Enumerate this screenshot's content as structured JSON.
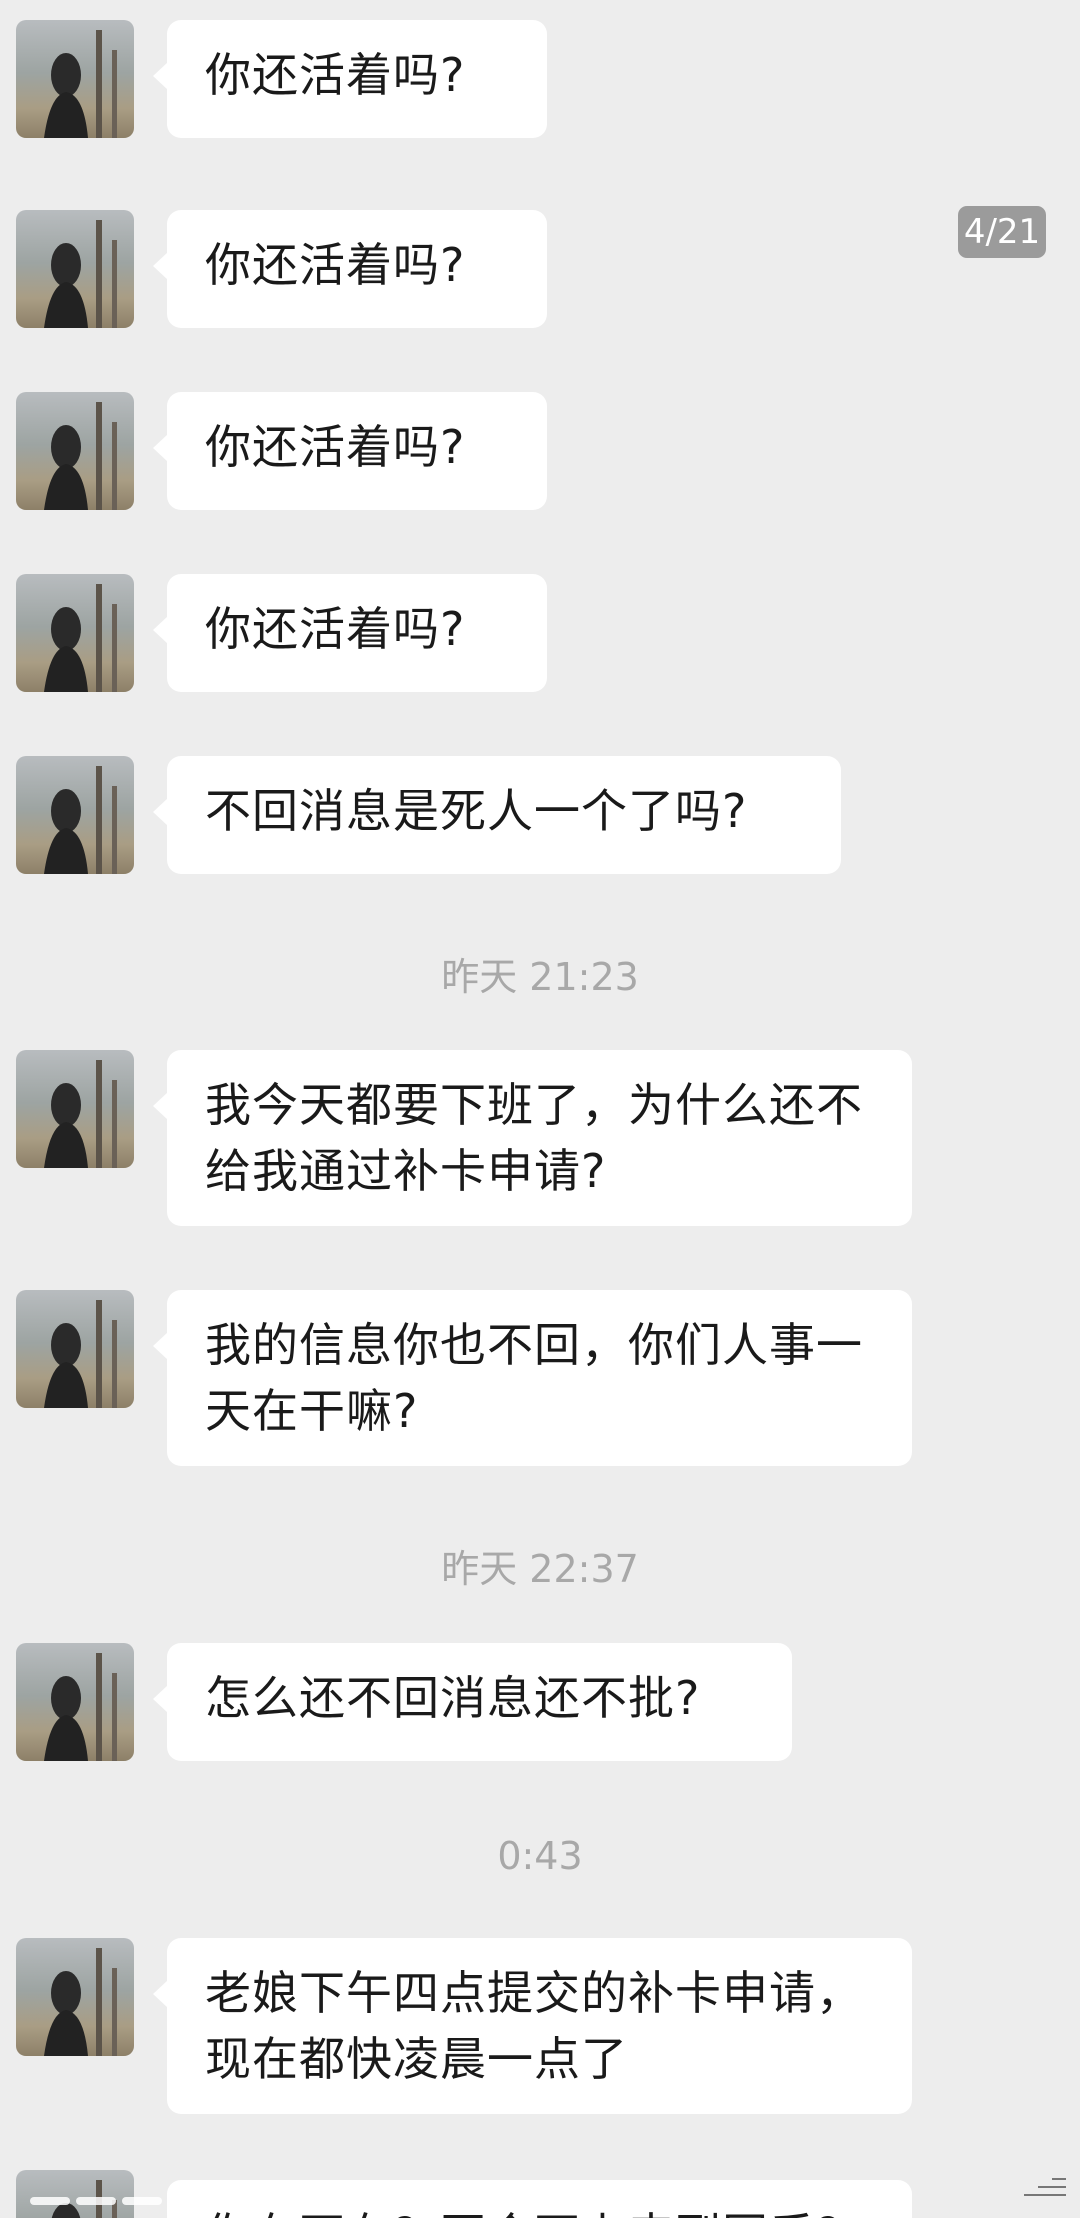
{
  "page_badge": "4/21",
  "messages": [
    {
      "text": "你还活着吗?"
    },
    {
      "text": "你还活着吗?"
    },
    {
      "text": "你还活着吗?"
    },
    {
      "text": "你还活着吗?"
    },
    {
      "text": "不回消息是死人一个了吗?"
    },
    {
      "text": "我今天都要下班了，为什么还不给我通过补卡申请?"
    },
    {
      "text": "我的信息你也不回，你们人事一天在干嘛?"
    },
    {
      "text": "怎么还不回消息还不批?"
    },
    {
      "text": "老娘下午四点提交的补卡申请，现在都快凌晨一点了"
    },
    {
      "text": "你在不在？再合不上来到同乎？"
    }
  ],
  "timestamps": [
    "昨天  21:23",
    "昨天  22:37",
    "0:43"
  ],
  "colors": {
    "background": "#ededed",
    "bubble": "#ffffff",
    "timestamp": "#a8a8a8",
    "badge": "#9b9b9b"
  }
}
